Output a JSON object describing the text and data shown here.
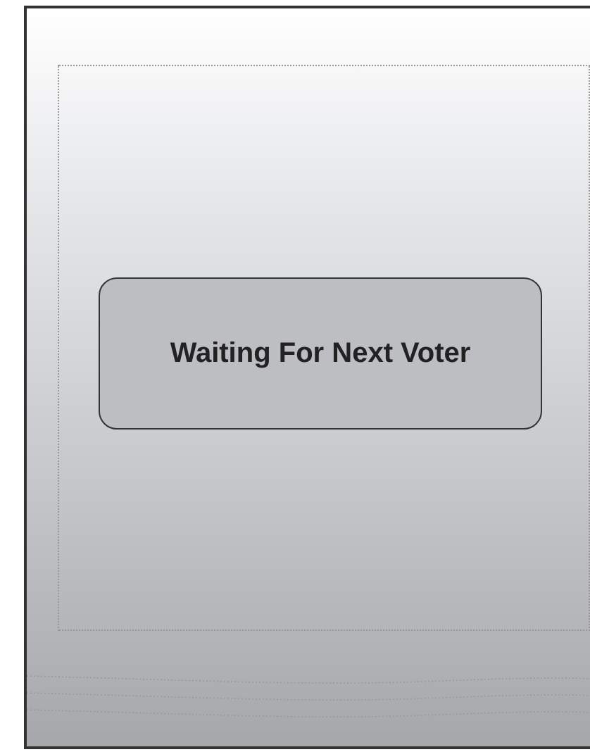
{
  "status_message": "Waiting For Next Voter"
}
